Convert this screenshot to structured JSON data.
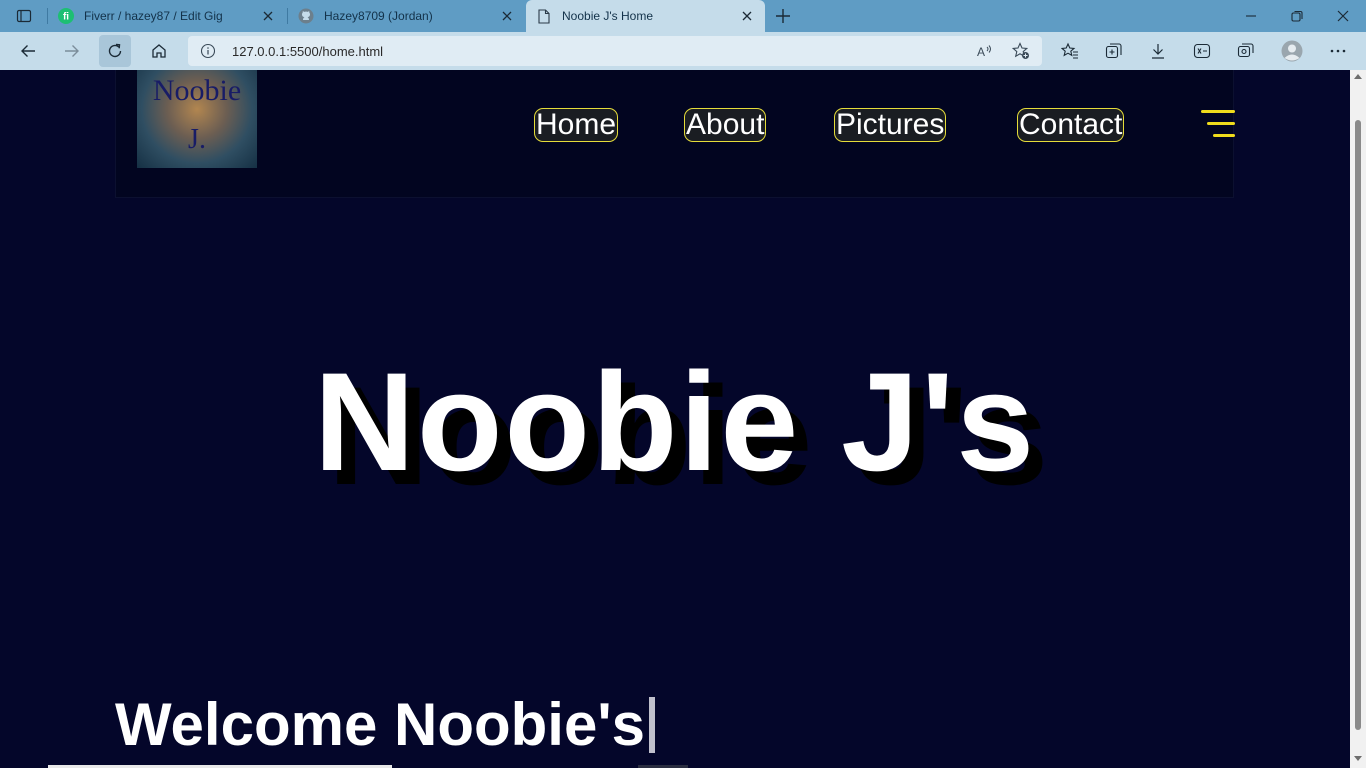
{
  "browser": {
    "tabs": [
      {
        "title": "Fiverr / hazey87 / Edit Gig",
        "icon": "fiverr-icon",
        "active": false
      },
      {
        "title": "Hazey8709 (Jordan)",
        "icon": "github-icon",
        "active": false
      },
      {
        "title": "Noobie J's Home",
        "icon": "page-icon",
        "active": true
      }
    ],
    "url": "127.0.0.1:5500/home.html"
  },
  "site": {
    "logo": {
      "line1": "Noobie",
      "line2": "J."
    },
    "nav": [
      {
        "label": "Home"
      },
      {
        "label": "About"
      },
      {
        "label": "Pictures"
      },
      {
        "label": "Contact"
      }
    ],
    "hero_title": "Noobie J's",
    "welcome_text": "Welcome Noobie's"
  },
  "colors": {
    "page_background": "#04062a",
    "header_background": "#020520",
    "nav_border": "#e5dc3a",
    "hamburger": "#f0dc1c",
    "tab_bar": "#5f9cc4",
    "toolbar": "#c5dcea"
  }
}
